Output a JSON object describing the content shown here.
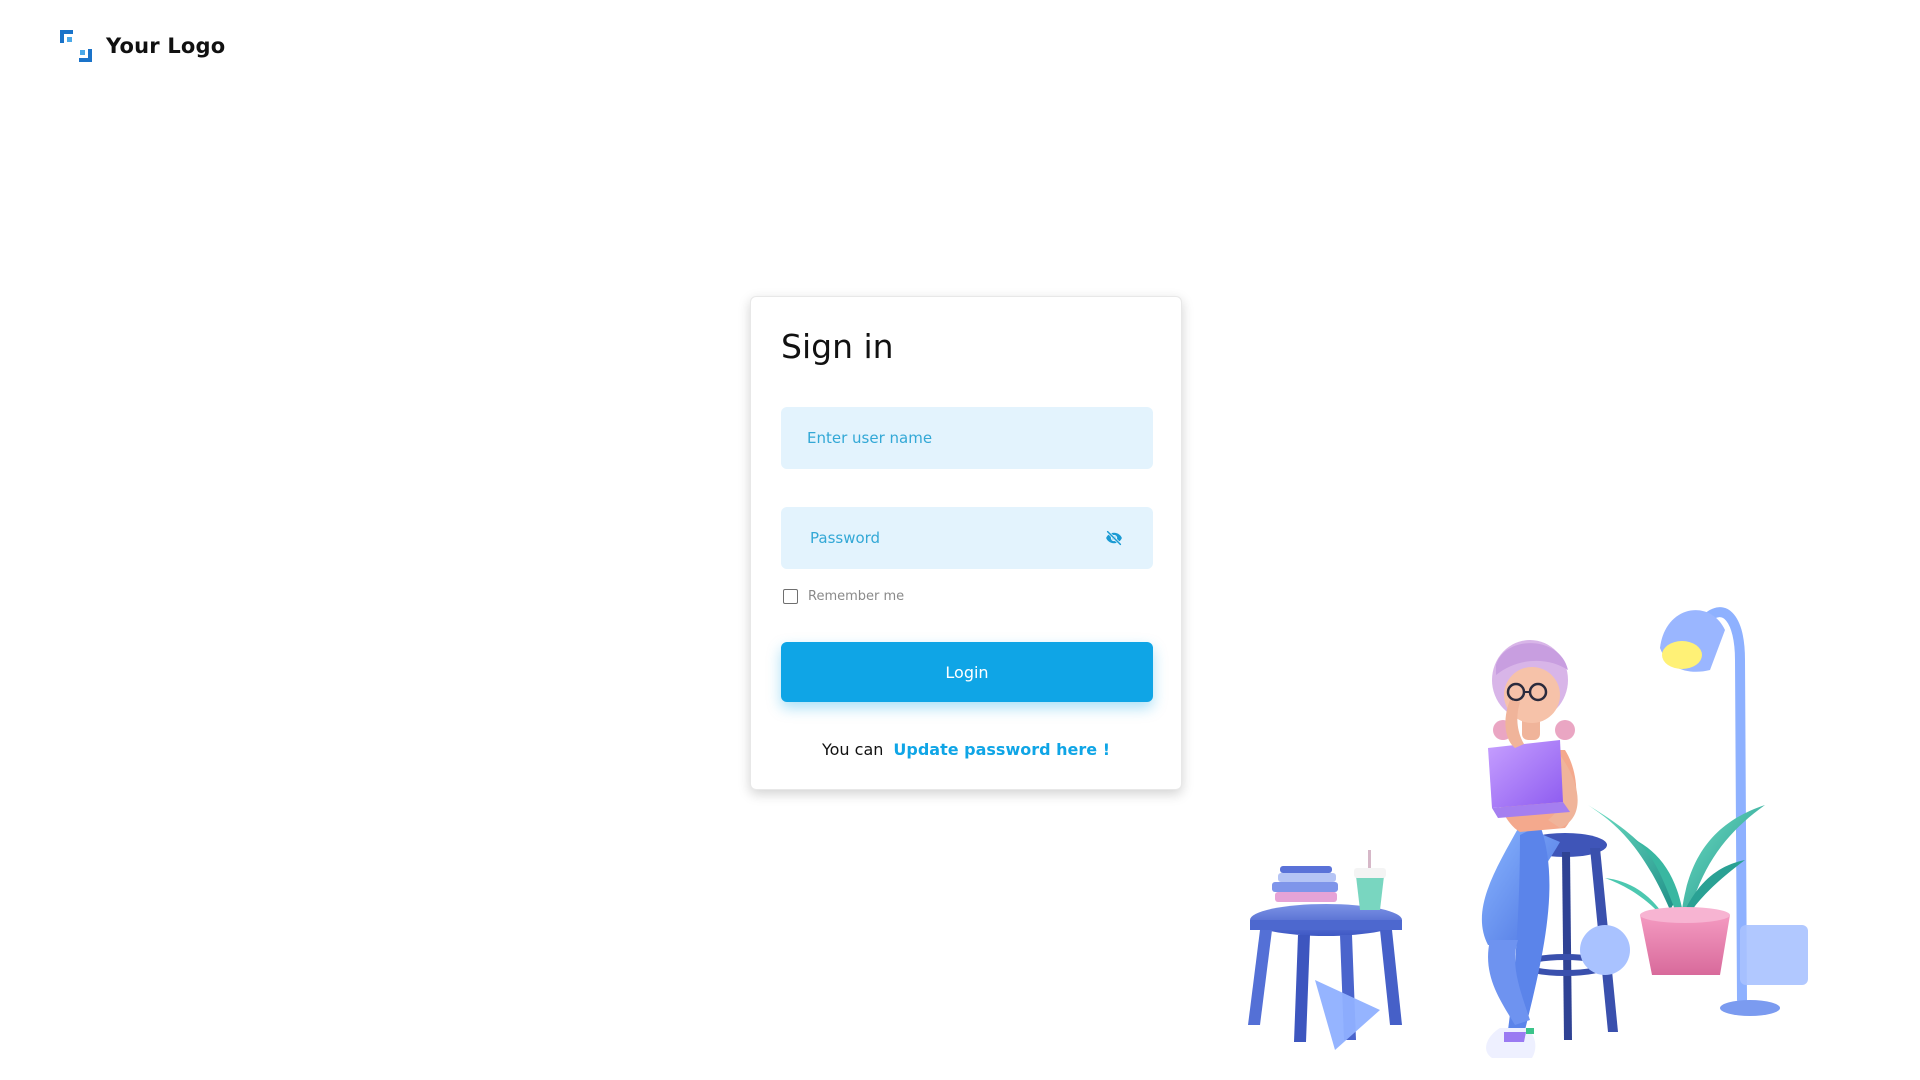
{
  "brand": {
    "logo_text": "Your Logo",
    "logo_icon": "bracket-logo-icon",
    "primary_color": "#0fa5e6",
    "secondary_color": "#4aa8e8"
  },
  "signin": {
    "title": "Sign in",
    "username_placeholder": "Enter user name",
    "password_placeholder": "Password",
    "password_toggle_icon": "eye-slash-icon",
    "remember_label": "Remember me",
    "remember_checked": false,
    "login_label": "Login",
    "update_prefix": "You can",
    "update_link": "Update password here !"
  },
  "illustration": {
    "description_icon": "person-with-laptop-illustration"
  }
}
